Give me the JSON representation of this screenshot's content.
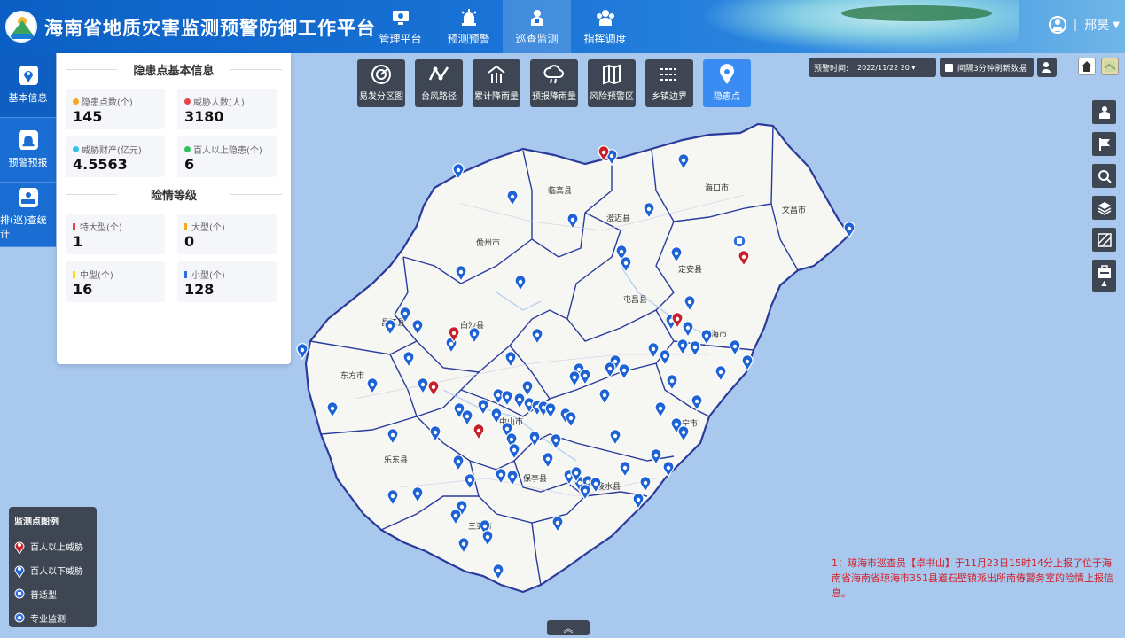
{
  "header": {
    "title": "海南省地质灾害监测预警防御工作平台",
    "nav": [
      {
        "label": "管理平台",
        "icon": "monitor-icon"
      },
      {
        "label": "预测预警",
        "icon": "alarm-icon"
      },
      {
        "label": "巡查监测",
        "icon": "inspector-icon",
        "active": true
      },
      {
        "label": "指挥调度",
        "icon": "commander-icon"
      }
    ],
    "user": {
      "separator": "|",
      "name": "邢昊"
    }
  },
  "leftnav": [
    {
      "label": "基本信息",
      "icon": "location-icon",
      "active": true
    },
    {
      "label": "预警预报",
      "icon": "alarm-icon"
    },
    {
      "label": "排(巡)查统计",
      "icon": "inspect-stats-icon"
    }
  ],
  "panel": {
    "section1_title": "隐患点基本信息",
    "cards1": [
      {
        "label": "隐患点数(个)",
        "value": "145",
        "color": "#f5a623"
      },
      {
        "label": "威胁人数(人)",
        "value": "3180",
        "color": "#e8424a"
      },
      {
        "label": "威胁财产(亿元)",
        "value": "4.5563",
        "color": "#32c5e9"
      },
      {
        "label": "百人以上隐患(个)",
        "value": "6",
        "color": "#2fc25b"
      }
    ],
    "section2_title": "险情等级",
    "cards2": [
      {
        "label": "特大型(个)",
        "value": "1",
        "color": "#e8424a"
      },
      {
        "label": "大型(个)",
        "value": "0",
        "color": "#f5a623"
      },
      {
        "label": "中型(个)",
        "value": "16",
        "color": "#fadb14"
      },
      {
        "label": "小型(个)",
        "value": "128",
        "color": "#2f6fe0"
      }
    ]
  },
  "tools": [
    {
      "label": "易发分区图"
    },
    {
      "label": "台风路径"
    },
    {
      "label": "累计降雨量"
    },
    {
      "label": "预报降雨量"
    },
    {
      "label": "风险预警区"
    },
    {
      "label": "乡镇边界"
    },
    {
      "label": "隐患点",
      "active": true
    }
  ],
  "timebar": {
    "label": "预警时间:",
    "value": "2022/11/22 20 ▾"
  },
  "refresh": {
    "label": "间隔3分钟刷新数据"
  },
  "map": {
    "labels": [
      "临高县",
      "海口市",
      "文昌市",
      "澄迈县",
      "儋州市",
      "定安县",
      "屯昌县",
      "白沙县",
      "昌江县",
      "琼海市",
      "东方市",
      "万宁市",
      "乐东县",
      "保亭县",
      "陵水县",
      "三亚市",
      "中山市"
    ],
    "pins_red": 6,
    "pins_blue_approx": 139
  },
  "legend": {
    "title": "监测点图例",
    "items": [
      {
        "label": "百人以上威胁",
        "icon": "red-pin-icon",
        "color": "#c8202a"
      },
      {
        "label": "百人以下威胁",
        "icon": "blue-pin-icon",
        "color": "#1e63d6"
      },
      {
        "label": "普适型",
        "icon": "general-monitor-icon",
        "color": "#2f6fe0"
      },
      {
        "label": "专业监测",
        "icon": "pro-monitor-icon",
        "color": "#2f6fe0"
      }
    ]
  },
  "notice": "1：琼海市巡查员【卓书山】于11月23日15时14分上报了位于海南省海南省琼海市351县道石壁镇派出所南偆警务室的险情上报信息。",
  "bottom_toggle": "︽"
}
